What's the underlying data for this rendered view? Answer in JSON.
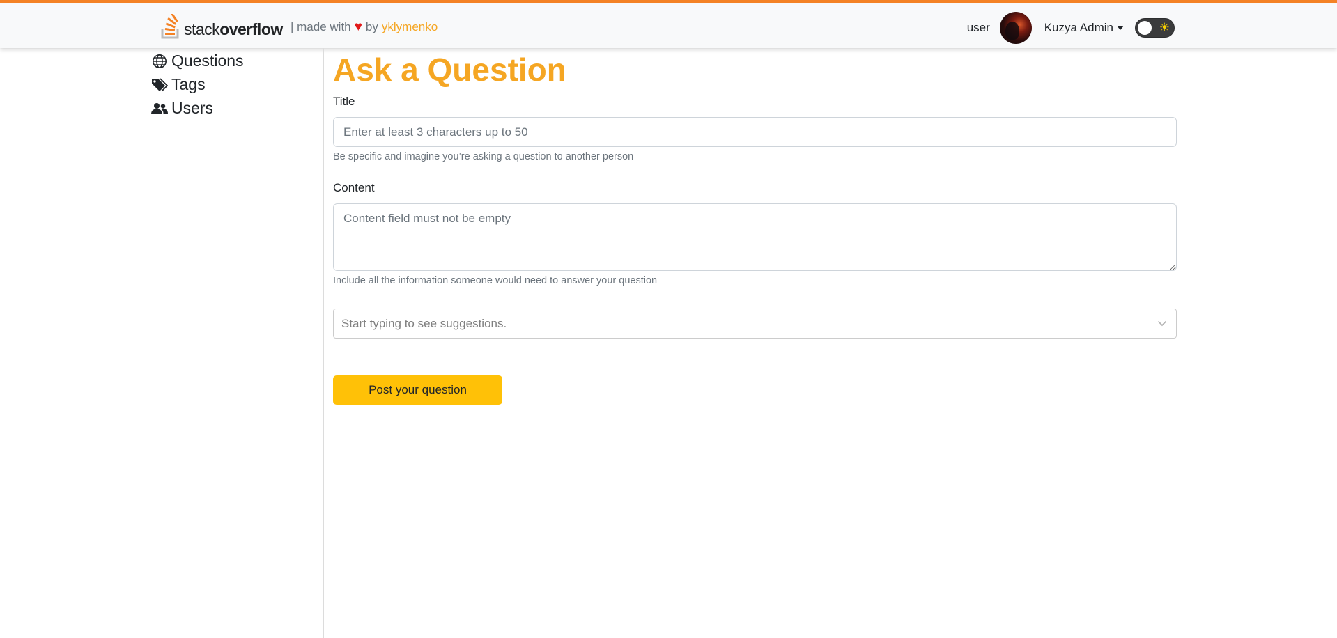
{
  "header": {
    "logo_thin": "stack",
    "logo_bold": "overflow",
    "credit_prefix": "| made with",
    "credit_by": "by",
    "credit_author": "yklymenko",
    "user_role": "user",
    "user_name": "Kuzya Admin",
    "theme_toggle_icon": "sun-icon"
  },
  "sidebar": {
    "items": [
      {
        "label": "Questions",
        "icon": "globe-icon"
      },
      {
        "label": "Tags",
        "icon": "tags-icon"
      },
      {
        "label": "Users",
        "icon": "users-icon"
      }
    ]
  },
  "form": {
    "title": "Ask a Question",
    "title_label": "Title",
    "title_placeholder": "Enter at least 3 characters up to 50",
    "title_help": "Be specific and imagine you’re asking a question to another person",
    "content_label": "Content",
    "content_placeholder": "Content field must not be empty",
    "content_help": "Include all the information someone would need to answer your question",
    "tags_placeholder": "Start typing to see suggestions.",
    "submit_label": "Post your question"
  },
  "colors": {
    "accent": "#f5a623",
    "brand_stripe": "#f48225",
    "submit_button": "#ffc107",
    "heart": "#e11919"
  }
}
